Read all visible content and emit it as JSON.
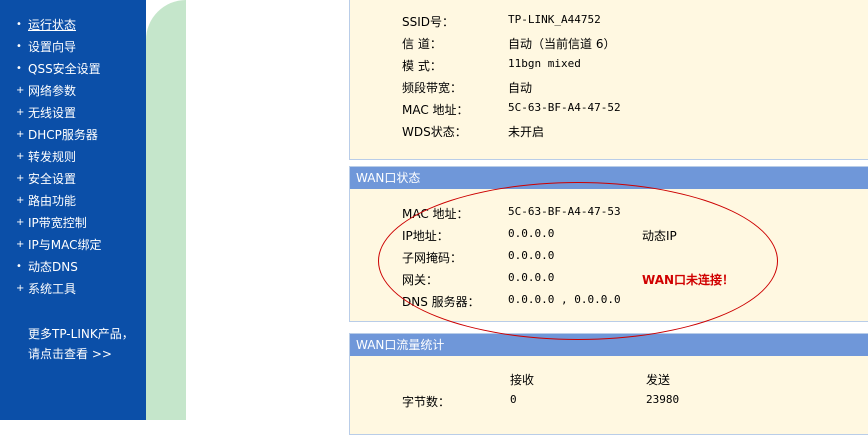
{
  "sidebar": {
    "items": [
      {
        "label": "运行状态",
        "active": true
      },
      {
        "label": "设置向导"
      },
      {
        "label": "QSS安全设置"
      },
      {
        "label": "网络参数"
      },
      {
        "label": "无线设置"
      },
      {
        "label": "DHCP服务器"
      },
      {
        "label": "转发规则"
      },
      {
        "label": "安全设置"
      },
      {
        "label": "路由功能"
      },
      {
        "label": "IP带宽控制"
      },
      {
        "label": "IP与MAC绑定"
      },
      {
        "label": "动态DNS"
      },
      {
        "label": "系统工具"
      }
    ],
    "promo_line1": "更多TP-LINK产品，",
    "promo_line2": "请点击查看 >>"
  },
  "wireless": {
    "rows": [
      {
        "label": "SSID号：",
        "value": "TP-LINK_A44752"
      },
      {
        "label": "信  道：",
        "value": "自动（当前信道 6）"
      },
      {
        "label": "模  式：",
        "value": "11bgn mixed"
      },
      {
        "label": "频段带宽：",
        "value": "自动"
      },
      {
        "label": "MAC 地址：",
        "value": "5C-63-BF-A4-47-52"
      },
      {
        "label": "WDS状态：",
        "value": "未开启"
      }
    ]
  },
  "wan": {
    "title": "WAN口状态",
    "rows": [
      {
        "label": "MAC 地址：",
        "value": "5C-63-BF-A4-47-53",
        "extra": ""
      },
      {
        "label": "IP地址：",
        "value": "0.0.0.0",
        "extra": "动态IP"
      },
      {
        "label": "子网掩码：",
        "value": "0.0.0.0",
        "extra": ""
      },
      {
        "label": "网关：",
        "value": "0.0.0.0",
        "extra": "WAN口未连接！"
      },
      {
        "label": "DNS 服务器：",
        "value": "0.0.0.0 , 0.0.0.0",
        "extra": ""
      }
    ]
  },
  "traffic": {
    "title": "WAN口流量统计",
    "col_recv": "接收",
    "col_send": "发送",
    "rows": [
      {
        "label": "字节数：",
        "recv": "0",
        "send": "23980"
      }
    ]
  },
  "colors": {
    "sidebar": "#0b4fa8",
    "panel_header": "#6f97d9",
    "panel_bg": "#fff8e1",
    "warning": "#d00000",
    "annotation": "#cc0000"
  }
}
